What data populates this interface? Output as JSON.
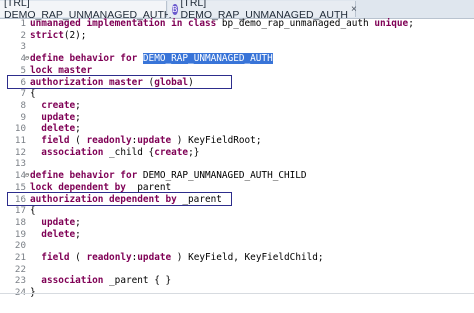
{
  "tabs": [
    {
      "label": "[TRL] DEMO_RAP_UNMANAGED_AUTH",
      "close": "×",
      "active": true
    },
    {
      "label": "[TRL] DEMO_RAP_UNMANAGED_AUTH",
      "icon": "B",
      "close": "×",
      "active": false
    }
  ],
  "editor": {
    "lines": [
      {
        "n": "1",
        "code": "unmanaged implementation in class bp_demo_rap_unmanaged_auth unique;"
      },
      {
        "n": "2",
        "code": "strict(2);"
      },
      {
        "n": "3",
        "code": ""
      },
      {
        "n": "4",
        "code": "define behavior for DEMO_RAP_UNMANAGED_AUTH"
      },
      {
        "n": "5",
        "code": "lock master"
      },
      {
        "n": "6",
        "code": "authorization master (global)"
      },
      {
        "n": "7",
        "code": "{"
      },
      {
        "n": "8",
        "code": "  create;"
      },
      {
        "n": "9",
        "code": "  update;"
      },
      {
        "n": "10",
        "code": "  delete;"
      },
      {
        "n": "11",
        "code": "  field ( readonly:update ) KeyFieldRoot;"
      },
      {
        "n": "12",
        "code": "  association _child {create;}"
      },
      {
        "n": "13",
        "code": ""
      },
      {
        "n": "14",
        "code": "define behavior for DEMO_RAP_UNMANAGED_AUTH_CHILD"
      },
      {
        "n": "15",
        "code": "lock dependent by _parent"
      },
      {
        "n": "16",
        "code": "authorization dependent by _parent"
      },
      {
        "n": "17",
        "code": "{"
      },
      {
        "n": "18",
        "code": "  update;"
      },
      {
        "n": "19",
        "code": "  delete;"
      },
      {
        "n": "20",
        "code": ""
      },
      {
        "n": "21",
        "code": "  field ( readonly:update ) KeyField, KeyFieldChild;"
      },
      {
        "n": "22",
        "code": ""
      },
      {
        "n": "23",
        "code": "  association _parent { }"
      },
      {
        "n": "24",
        "code": "}"
      }
    ]
  },
  "colors": {
    "keyword": "#7f0055",
    "selection": "#3874d8",
    "highlight_box": "#2d2d8c"
  }
}
